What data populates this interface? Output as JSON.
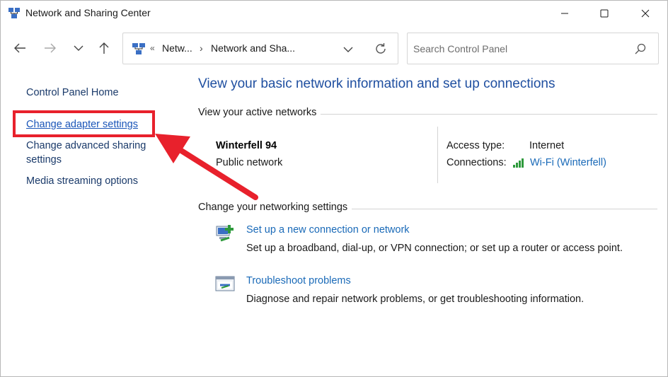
{
  "window": {
    "title": "Network and Sharing Center",
    "controls": {
      "minimize": "minimize-icon",
      "maximize": "maximize-icon",
      "close": "close-icon"
    }
  },
  "address_bar": {
    "overflow": "«",
    "breadcrumbs": [
      "Netw...",
      "Network and Sha..."
    ],
    "separator": "›"
  },
  "search": {
    "placeholder": "Search Control Panel"
  },
  "left_pane": {
    "items": [
      {
        "label": "Control Panel Home"
      },
      {
        "label": "Change adapter settings"
      },
      {
        "label": "Change advanced sharing settings"
      },
      {
        "label": "Media streaming options"
      }
    ]
  },
  "main": {
    "heading": "View your basic network information and set up connections",
    "active_networks_label": "View your active networks",
    "network": {
      "name": "Winterfell 94",
      "category": "Public network",
      "access_type_label": "Access type:",
      "access_type_value": "Internet",
      "connections_label": "Connections:",
      "connections_value": "Wi-Fi (Winterfell)"
    },
    "change_settings_label": "Change your networking settings",
    "tasks": [
      {
        "title": "Set up a new connection or network",
        "description": "Set up a broadband, dial-up, or VPN connection; or set up a router or access point."
      },
      {
        "title": "Troubleshoot problems",
        "description": "Diagnose and repair network problems, or get troubleshooting information."
      }
    ]
  },
  "colors": {
    "accent_link": "#1a6ab8",
    "heading": "#1f4fa0",
    "annotation_red": "#e8212c"
  }
}
